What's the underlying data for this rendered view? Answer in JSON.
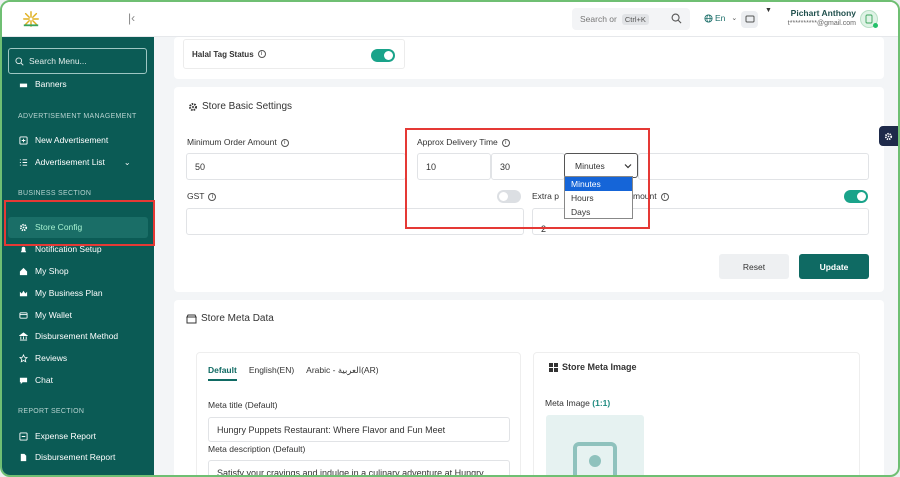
{
  "topbar": {
    "search_placeholder": "Search or",
    "search_shortcut": "Ctrl+K",
    "language": "En",
    "user_name": "Pichart Anthony",
    "user_email": "t**********@gmail.com"
  },
  "sidebar": {
    "search_placeholder": "Search Menu...",
    "items_top": [
      {
        "label": "Banners"
      }
    ],
    "sections": {
      "ads": "ADVERTISEMENT MANAGEMENT",
      "business": "BUSINESS SECTION",
      "report": "REPORT SECTION"
    },
    "ads_items": [
      {
        "label": "New Advertisement"
      },
      {
        "label": "Advertisement List"
      }
    ],
    "business_items": [
      {
        "label": "Store Config"
      },
      {
        "label": "Notification Setup"
      },
      {
        "label": "My Shop"
      },
      {
        "label": "My Business Plan"
      },
      {
        "label": "My Wallet"
      },
      {
        "label": "Disbursement Method"
      },
      {
        "label": "Reviews"
      },
      {
        "label": "Chat"
      }
    ],
    "report_items": [
      {
        "label": "Expense Report"
      },
      {
        "label": "Disbursement Report"
      }
    ]
  },
  "halal": {
    "label": "Halal Tag Status"
  },
  "store_basic": {
    "title": "Store Basic Settings",
    "min_order_label": "Minimum Order Amount",
    "min_order_value": "50",
    "delivery_label": "Approx Delivery Time",
    "delivery_min": "10",
    "delivery_max": "30",
    "delivery_unit": "Minutes",
    "unit_options": [
      "Minutes",
      "Hours",
      "Days"
    ],
    "gst_label": "GST",
    "extra_label_left": "Extra p",
    "extra_label_right": "mount",
    "extra_value": "2",
    "reset_label": "Reset",
    "update_label": "Update"
  },
  "meta": {
    "title": "Store Meta Data",
    "tabs": [
      "Default",
      "English(EN)",
      "Arabic - العربية(AR)"
    ],
    "meta_title_label": "Meta title (Default)",
    "meta_title_value": "Hungry Puppets Restaurant: Where Flavor and Fun Meet",
    "meta_desc_label": "Meta description (Default)",
    "meta_desc_value": "Satisfy your cravings and indulge in a culinary adventure at Hungry",
    "image_title": "Store Meta Image",
    "image_label": "Meta Image",
    "image_ratio": "(1:1)"
  },
  "colors": {
    "primary": "#0b5b55",
    "accent": "#1aa38a",
    "highlight": "#e53935"
  }
}
